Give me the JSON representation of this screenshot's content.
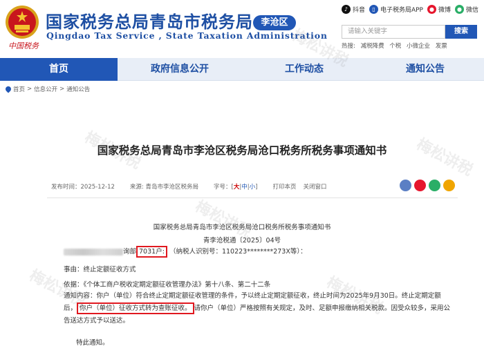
{
  "header": {
    "title_cn": "国家税务总局青岛市税务局",
    "title_en": "Qingdao Tax Service , State Taxation Administration",
    "district": "李沧区",
    "signature": "中国税务",
    "top_links": [
      {
        "label": "抖音",
        "icon": "tiktok-icon",
        "color": "#111111"
      },
      {
        "label": "电子税务局APP",
        "icon": "phone-app-icon",
        "color": "#2157b6"
      },
      {
        "label": "微博",
        "icon": "weibo-icon",
        "color": "#e6162d"
      },
      {
        "label": "微信",
        "icon": "wechat-icon",
        "color": "#2aae67"
      }
    ],
    "search": {
      "placeholder": "请输入关键字",
      "button": "搜索",
      "hot_label": "热搜:",
      "hot_terms": [
        "减税降费",
        "个税",
        "小微企业",
        "发票"
      ]
    }
  },
  "nav": {
    "items": [
      "首页",
      "政府信息公开",
      "工作动态",
      "通知公告"
    ],
    "active_index": 0
  },
  "breadcrumb": [
    "首页",
    "信息公开",
    "通知公告"
  ],
  "article": {
    "title": "国家税务总局青岛市李沧区税务局沧口税务所税务事项通知书",
    "meta": {
      "date": "发布时间：2025-12-12",
      "source": "来源: 青岛市李沧区税务局",
      "size_label": "字号：",
      "size_large": "大",
      "size_medium": "中",
      "size_small": "小",
      "print": "打印本页",
      "close": "关闭窗口"
    },
    "doc_head": "国家税务总局青岛市李沧区税务局沧口税务所税务事项通知书",
    "doc_number": "青李沧税通〔2025〕04号",
    "addressee_mid": "询部",
    "addressee_hl": "7031户:",
    "addressee_tail": "（纳税人识别号：110223********273X等）：",
    "reason": "事由：终止定额征收方式",
    "basis": "依据：《个体工商户税收定期定额征收管理办法》第十八条、第二十二条",
    "content_1": "通知内容：你户（单位）符合终止定期定额征收管理的条件，予以终止定期定额征收，终止时间为2025年9月30日。终止定期定额后，",
    "content_hl": "你户（单位）征收方式转为查账征收。",
    "content_2": "请你户（单位）严格按照有关规定，及时、足额申报缴纳相关税款。因受众较多，采用公告送达方式予以送达。",
    "closing": "特此通知。"
  },
  "colors": {
    "brand_blue": "#1e4fa3",
    "nav_active": "#2157b6",
    "highlight_red": "#e0181f"
  }
}
